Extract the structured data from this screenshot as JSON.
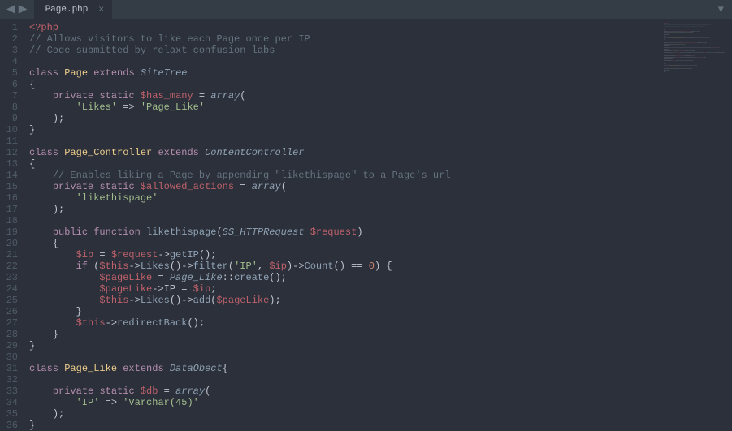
{
  "tab": {
    "title": "Page.php"
  },
  "code": {
    "lines": [
      [
        [
          "php",
          "<?php"
        ]
      ],
      [
        [
          "comment",
          "// Allows visitors to like each Page once per IP"
        ]
      ],
      [
        [
          "comment",
          "// Code submitted by relaxt confusion labs"
        ]
      ],
      [],
      [
        [
          "keyword",
          "class"
        ],
        [
          "default",
          " "
        ],
        [
          "classname",
          "Page"
        ],
        [
          "default",
          " "
        ],
        [
          "keyword",
          "extends"
        ],
        [
          "default",
          " "
        ],
        [
          "type",
          "SiteTree"
        ]
      ],
      [
        [
          "punc",
          "{"
        ]
      ],
      [
        [
          "default",
          "    "
        ],
        [
          "keyword",
          "private"
        ],
        [
          "default",
          " "
        ],
        [
          "keyword",
          "static"
        ],
        [
          "default",
          " "
        ],
        [
          "var",
          "$has_many"
        ],
        [
          "default",
          " "
        ],
        [
          "op",
          "="
        ],
        [
          "default",
          " "
        ],
        [
          "typecall",
          "array"
        ],
        [
          "punc",
          "("
        ]
      ],
      [
        [
          "default",
          "        "
        ],
        [
          "string",
          "'Likes'"
        ],
        [
          "default",
          " "
        ],
        [
          "op",
          "=>"
        ],
        [
          "default",
          " "
        ],
        [
          "string",
          "'Page_Like'"
        ]
      ],
      [
        [
          "default",
          "    "
        ],
        [
          "punc",
          ");"
        ]
      ],
      [
        [
          "punc",
          "}"
        ]
      ],
      [],
      [
        [
          "keyword",
          "class"
        ],
        [
          "default",
          " "
        ],
        [
          "classname",
          "Page_Controller"
        ],
        [
          "default",
          " "
        ],
        [
          "keyword",
          "extends"
        ],
        [
          "default",
          " "
        ],
        [
          "type",
          "ContentController"
        ]
      ],
      [
        [
          "punc",
          "{"
        ]
      ],
      [
        [
          "default",
          "    "
        ],
        [
          "comment",
          "// Enables liking a Page by appending \"likethispage\" to a Page's url"
        ]
      ],
      [
        [
          "default",
          "    "
        ],
        [
          "keyword",
          "private"
        ],
        [
          "default",
          " "
        ],
        [
          "keyword",
          "static"
        ],
        [
          "default",
          " "
        ],
        [
          "var",
          "$allowed_actions"
        ],
        [
          "default",
          " "
        ],
        [
          "op",
          "="
        ],
        [
          "default",
          " "
        ],
        [
          "typecall",
          "array"
        ],
        [
          "punc",
          "("
        ]
      ],
      [
        [
          "default",
          "        "
        ],
        [
          "string",
          "'likethispage'"
        ]
      ],
      [
        [
          "default",
          "    "
        ],
        [
          "punc",
          ");"
        ]
      ],
      [],
      [
        [
          "default",
          "    "
        ],
        [
          "keyword",
          "public"
        ],
        [
          "default",
          " "
        ],
        [
          "keyword",
          "function"
        ],
        [
          "default",
          " "
        ],
        [
          "funcdef",
          "likethispage"
        ],
        [
          "punc",
          "("
        ],
        [
          "type",
          "SS_HTTPRequest"
        ],
        [
          "default",
          " "
        ],
        [
          "var",
          "$request"
        ],
        [
          "punc",
          ")"
        ]
      ],
      [
        [
          "default",
          "    "
        ],
        [
          "punc",
          "{"
        ]
      ],
      [
        [
          "default",
          "        "
        ],
        [
          "var",
          "$ip"
        ],
        [
          "default",
          " "
        ],
        [
          "op",
          "="
        ],
        [
          "default",
          " "
        ],
        [
          "var",
          "$request"
        ],
        [
          "op",
          "->"
        ],
        [
          "func",
          "getIP"
        ],
        [
          "punc",
          "();"
        ]
      ],
      [
        [
          "default",
          "        "
        ],
        [
          "keyword",
          "if"
        ],
        [
          "default",
          " "
        ],
        [
          "punc",
          "("
        ],
        [
          "var",
          "$this"
        ],
        [
          "op",
          "->"
        ],
        [
          "func",
          "Likes"
        ],
        [
          "punc",
          "()"
        ],
        [
          "op",
          "->"
        ],
        [
          "func",
          "filter"
        ],
        [
          "punc",
          "("
        ],
        [
          "string",
          "'IP'"
        ],
        [
          "punc",
          ", "
        ],
        [
          "var",
          "$ip"
        ],
        [
          "punc",
          ")"
        ],
        [
          "op",
          "->"
        ],
        [
          "func",
          "Count"
        ],
        [
          "punc",
          "()"
        ],
        [
          "default",
          " "
        ],
        [
          "op",
          "=="
        ],
        [
          "default",
          " "
        ],
        [
          "number",
          "0"
        ],
        [
          "punc",
          ") {"
        ]
      ],
      [
        [
          "default",
          "            "
        ],
        [
          "var",
          "$pageLike"
        ],
        [
          "default",
          " "
        ],
        [
          "op",
          "="
        ],
        [
          "default",
          " "
        ],
        [
          "type",
          "Page_Like"
        ],
        [
          "op",
          "::"
        ],
        [
          "func",
          "create"
        ],
        [
          "punc",
          "();"
        ]
      ],
      [
        [
          "default",
          "            "
        ],
        [
          "var",
          "$pageLike"
        ],
        [
          "op",
          "->"
        ],
        [
          "default",
          "IP"
        ],
        [
          "default",
          " "
        ],
        [
          "op",
          "="
        ],
        [
          "default",
          " "
        ],
        [
          "var",
          "$ip"
        ],
        [
          "punc",
          ";"
        ]
      ],
      [
        [
          "default",
          "            "
        ],
        [
          "var",
          "$this"
        ],
        [
          "op",
          "->"
        ],
        [
          "func",
          "Likes"
        ],
        [
          "punc",
          "()"
        ],
        [
          "op",
          "->"
        ],
        [
          "func",
          "add"
        ],
        [
          "punc",
          "("
        ],
        [
          "var",
          "$pageLike"
        ],
        [
          "punc",
          ");"
        ]
      ],
      [
        [
          "default",
          "        "
        ],
        [
          "punc",
          "}"
        ]
      ],
      [
        [
          "default",
          "        "
        ],
        [
          "var",
          "$this"
        ],
        [
          "op",
          "->"
        ],
        [
          "func",
          "redirectBack"
        ],
        [
          "punc",
          "();"
        ]
      ],
      [
        [
          "default",
          "    "
        ],
        [
          "punc",
          "}"
        ]
      ],
      [
        [
          "punc",
          "}"
        ]
      ],
      [],
      [
        [
          "keyword",
          "class"
        ],
        [
          "default",
          " "
        ],
        [
          "classname",
          "Page_Like"
        ],
        [
          "default",
          " "
        ],
        [
          "keyword",
          "extends"
        ],
        [
          "default",
          " "
        ],
        [
          "type",
          "DataObect"
        ],
        [
          "punc",
          "{"
        ]
      ],
      [],
      [
        [
          "default",
          "    "
        ],
        [
          "keyword",
          "private"
        ],
        [
          "default",
          " "
        ],
        [
          "keyword",
          "static"
        ],
        [
          "default",
          " "
        ],
        [
          "var",
          "$db"
        ],
        [
          "default",
          " "
        ],
        [
          "op",
          "="
        ],
        [
          "default",
          " "
        ],
        [
          "typecall",
          "array"
        ],
        [
          "punc",
          "("
        ]
      ],
      [
        [
          "default",
          "        "
        ],
        [
          "string",
          "'IP'"
        ],
        [
          "default",
          " "
        ],
        [
          "op",
          "=>"
        ],
        [
          "default",
          " "
        ],
        [
          "string",
          "'Varchar(45)'"
        ]
      ],
      [
        [
          "default",
          "    "
        ],
        [
          "punc",
          ");"
        ]
      ],
      [
        [
          "punc",
          "}"
        ]
      ]
    ]
  }
}
